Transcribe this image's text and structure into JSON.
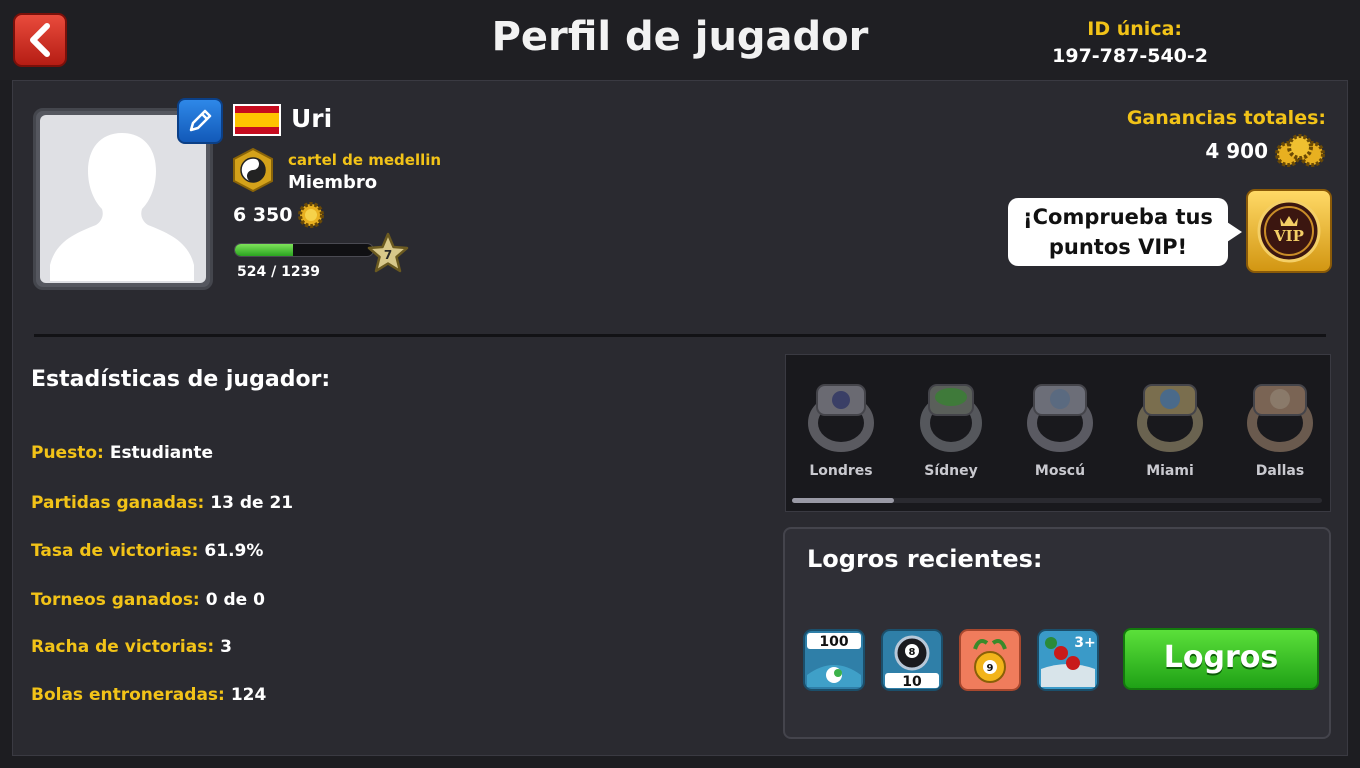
{
  "header": {
    "title": "Perfil de jugador",
    "uid_label": "ID única:",
    "uid_value": "197-787-540-2"
  },
  "profile": {
    "name": "Uri",
    "club_name": "cartel de medellin",
    "club_role": "Miembro",
    "coins": "6 350",
    "level": "7",
    "xp_text": "524 / 1239",
    "xp_fraction": 0.42
  },
  "earnings": {
    "label": "Ganancias totales:",
    "value": "4 900"
  },
  "vip": {
    "line1": "¡Comprueba tus",
    "line2": "puntos VIP!",
    "badge": "VIP"
  },
  "stats": {
    "title": "Estadísticas de jugador:",
    "items": [
      {
        "label": "Puesto:",
        "value": "Estudiante"
      },
      {
        "label": "Partidas ganadas:",
        "value": "13 de 21"
      },
      {
        "label": "Tasa de victorias:",
        "value": "61.9%"
      },
      {
        "label": "Torneos ganados:",
        "value": "0 de 0"
      },
      {
        "label": "Racha de victorias:",
        "value": "3"
      },
      {
        "label": "Bolas entroneradas:",
        "value": "124"
      }
    ]
  },
  "rings": [
    "Londres",
    "Sídney",
    "Moscú",
    "Miami",
    "Dallas"
  ],
  "achievements": {
    "title": "Logros recientes:",
    "icon1_text": "100",
    "icon2_text": "10",
    "icon3_text": "9",
    "icon4_text": "3+",
    "button": "Logros"
  },
  "colors": {
    "accent_gold": "#f2c318",
    "panel": "#2a2a30",
    "green_button": "#2fbf20",
    "back_red": "#d53a2c"
  }
}
